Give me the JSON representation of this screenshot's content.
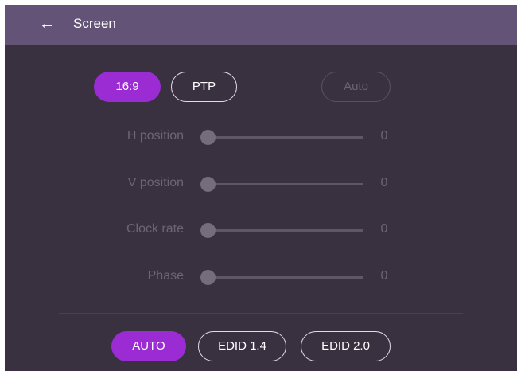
{
  "header": {
    "back_icon": "arrow-left-icon",
    "title": "Screen"
  },
  "aspect": {
    "options": [
      {
        "label": "16:9",
        "state": "selected"
      },
      {
        "label": "PTP",
        "state": "normal"
      }
    ],
    "auto_label": "Auto",
    "auto_state": "disabled"
  },
  "adjustments": [
    {
      "label": "H position",
      "value": "0"
    },
    {
      "label": "V position",
      "value": "0"
    },
    {
      "label": "Clock rate",
      "value": "0"
    },
    {
      "label": "Phase",
      "value": "0"
    }
  ],
  "edid": {
    "options": [
      {
        "label": "AUTO",
        "state": "selected"
      },
      {
        "label": "EDID 1.4",
        "state": "normal"
      },
      {
        "label": "EDID 2.0",
        "state": "normal"
      }
    ]
  },
  "colors": {
    "accent": "#9b2bd3",
    "header": "#635377",
    "background": "#3a3140"
  }
}
